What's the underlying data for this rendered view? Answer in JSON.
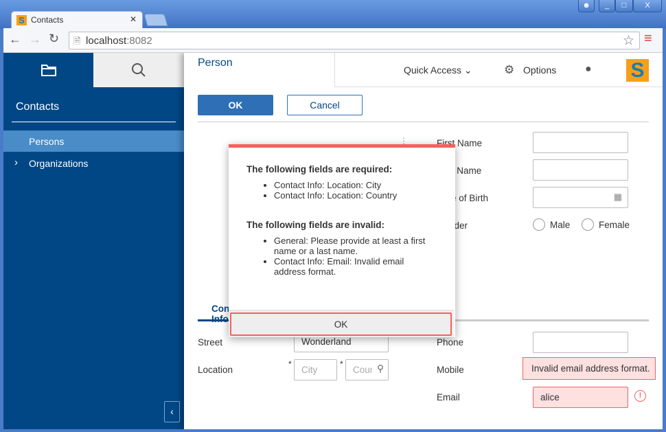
{
  "browser": {
    "tab_title": "Contacts",
    "url_host": "localhost",
    "url_port": ":8082",
    "window_buttons": [
      "user",
      "minimize",
      "maximize",
      "close"
    ]
  },
  "sidebar": {
    "title": "Contacts",
    "items": [
      {
        "label": "Persons",
        "selected": true
      },
      {
        "label": "Organizations",
        "expandable": true
      }
    ],
    "tabs": [
      "folder-icon",
      "search-icon"
    ]
  },
  "header": {
    "title": "Person",
    "quick_access": "Quick Access",
    "options": "Options"
  },
  "actions": {
    "ok": "OK",
    "cancel": "Cancel"
  },
  "form": {
    "first_name": "First Name",
    "last_name": "Last Name",
    "dob": "Date of Birth",
    "gender": "Gender",
    "male": "Male",
    "female": "Female",
    "tab": "Contact Info",
    "street": "Street",
    "street_value": "Wonderland",
    "location": "Location",
    "city_placeholder": "City",
    "country_placeholder": "Country",
    "phone": "Phone",
    "mobile": "Mobile",
    "email": "Email",
    "email_value": "alice",
    "email_error": "Invalid email address format."
  },
  "dialog": {
    "required_title": "The following fields are required:",
    "required": [
      "Contact Info: Location: City",
      "Contact Info: Location: Country"
    ],
    "invalid_title": "The following fields are invalid:",
    "invalid": [
      "General: Please provide at least a first name or a last name.",
      "Contact Info: Email: Invalid email address format."
    ],
    "ok": "OK"
  },
  "colors": {
    "brand": "#014786",
    "selected": "#4a8cc8",
    "error": "#f95f5f",
    "error_bg": "#fde0e0"
  }
}
